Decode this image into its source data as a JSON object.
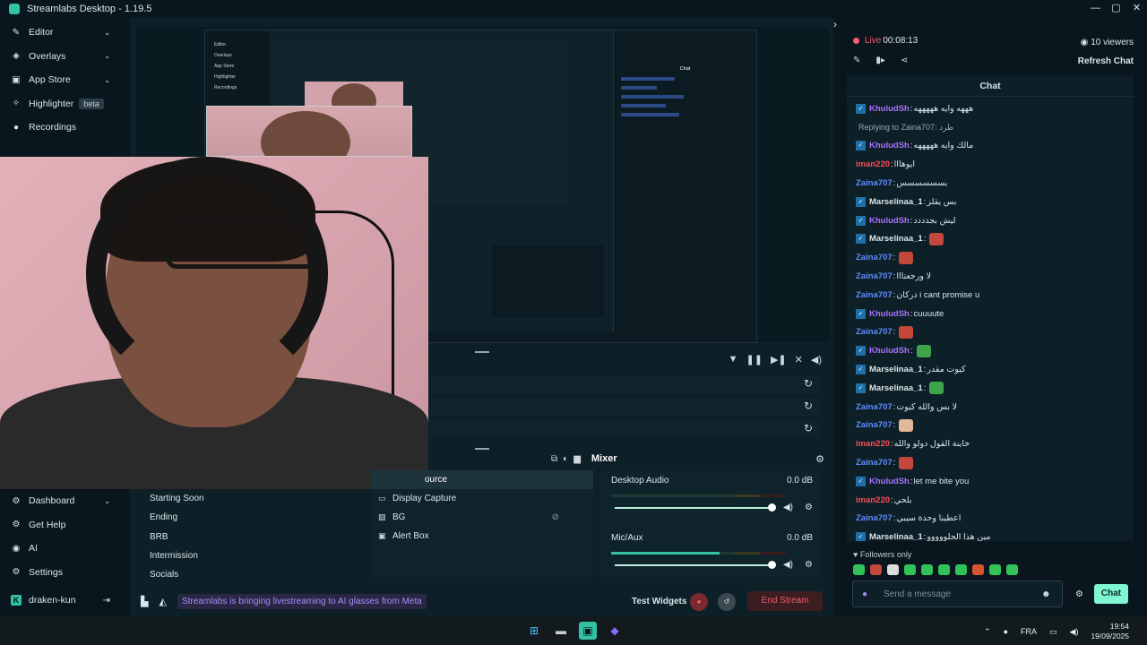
{
  "window": {
    "title": "Streamlabs Desktop - 1.19.5",
    "controls": [
      "—",
      "▢",
      "✕"
    ]
  },
  "sidebar": {
    "items": [
      {
        "label": "Editor",
        "icon": "pencil-icon",
        "glyph": "✎",
        "chev": "⌄"
      },
      {
        "label": "Overlays",
        "icon": "overlays-icon",
        "glyph": "◈",
        "chev": "⌄"
      },
      {
        "label": "App Store",
        "icon": "store-icon",
        "glyph": "▣",
        "chev": "⌄"
      },
      {
        "label": "Highlighter",
        "icon": "highlighter-icon",
        "glyph": "✧",
        "badge": "beta"
      },
      {
        "label": "Recordings",
        "icon": "recordings-icon",
        "glyph": "●"
      }
    ],
    "bottom": [
      {
        "label": "Dashboard",
        "glyph": "⚙",
        "icon": "dashboard-icon",
        "chev": "⌄"
      },
      {
        "label": "Get Help",
        "glyph": "⚙",
        "icon": "help-icon"
      },
      {
        "label": "AI",
        "glyph": "◉",
        "icon": "ai-icon"
      },
      {
        "label": "Settings",
        "glyph": "⚙",
        "icon": "settings-icon"
      }
    ],
    "user": {
      "name": "draken-kun",
      "badge": "K",
      "logout": "⇥"
    }
  },
  "preview_nested": {
    "sidebar_items": [
      "Editor",
      "Overlays",
      "App Store",
      "Highlighter",
      "Recordings"
    ],
    "chat_title": "Chat"
  },
  "scenes": [
    "Starting Soon",
    "Ending",
    "BRB",
    "Intermission",
    "Socials"
  ],
  "sources": {
    "active_partial": "ource",
    "items": [
      {
        "label": "Display Capture",
        "glyph": "▭",
        "icon": "display-capture-icon"
      },
      {
        "label": "BG",
        "glyph": "▨",
        "icon": "image-icon",
        "hidden": true
      },
      {
        "label": "Alert Box",
        "glyph": "▣",
        "icon": "alert-box-icon"
      }
    ]
  },
  "mixer": {
    "title": "Mixer",
    "channels": [
      {
        "name": "Desktop Audio",
        "db": "0.0 dB",
        "level": 0
      },
      {
        "name": "Mic/Aux",
        "db": "0.0 dB",
        "level": 0.62
      }
    ]
  },
  "footer": {
    "banner": "Streamlabs is bringing livestreaming to AI glasses from Meta",
    "test_widgets": "Test Widgets",
    "end_stream": "End Stream"
  },
  "chat": {
    "live_time": "00:08:13",
    "live_label": "Live",
    "viewers": "10 viewers",
    "refresh": "Refresh Chat",
    "header": "Chat",
    "reply": "Replying to Zaina707: طرد",
    "messages": [
      {
        "user": "KhuludSh",
        "color": "#a970ff",
        "text": "هههه وايه هههههه",
        "badge": true
      },
      {
        "user": "KhuludSh",
        "color": "#a970ff",
        "text": "مالك وايه هههههه",
        "badge": true
      },
      {
        "user": "iman220",
        "color": "#ff4a5a",
        "text": "ايوهااا",
        "badge": false
      },
      {
        "user": "Zaina707",
        "color": "#5f8cff",
        "text": "بسسسسسس",
        "badge": false
      },
      {
        "user": "Marselinaa_1",
        "color": "#dbe6ea",
        "text": "بس يقلز",
        "badge": true
      },
      {
        "user": "KhuludSh",
        "color": "#a970ff",
        "text": "ليش بجدددد",
        "badge": true
      },
      {
        "user": "Marselinaa_1",
        "color": "#dbe6ea",
        "text": "",
        "badge": true,
        "emote": "#c4473b"
      },
      {
        "user": "Zaina707",
        "color": "#5f8cff",
        "text": "",
        "badge": false,
        "emote": "#c4473b"
      },
      {
        "user": "Zaina707",
        "color": "#5f8cff",
        "text": "لا ورجعتااا",
        "badge": false
      },
      {
        "user": "Zaina707",
        "color": "#5f8cff",
        "text": "دركان i cant promise u",
        "badge": false
      },
      {
        "user": "KhuludSh",
        "color": "#a970ff",
        "text": "cuuuute",
        "badge": true
      },
      {
        "user": "Zaina707",
        "color": "#5f8cff",
        "text": "",
        "badge": false,
        "emote": "#c4473b"
      },
      {
        "user": "KhuludSh",
        "color": "#a970ff",
        "text": "",
        "badge": true,
        "emote": "#3ea34a"
      },
      {
        "user": "Marselinaa_1",
        "color": "#dbe6ea",
        "text": "كيوت مقدر",
        "badge": true
      },
      {
        "user": "Marselinaa_1",
        "color": "#dbe6ea",
        "text": "",
        "badge": true,
        "emote": "#3ea34a"
      },
      {
        "user": "Zaina707",
        "color": "#5f8cff",
        "text": "لا بس والله كيوت",
        "badge": false
      },
      {
        "user": "Zaina707",
        "color": "#5f8cff",
        "text": "",
        "badge": false,
        "emote": "#e0b89a"
      },
      {
        "user": "iman220",
        "color": "#ff4a5a",
        "text": "خاينة القول دولو والله",
        "badge": false
      },
      {
        "user": "Zaina707",
        "color": "#5f8cff",
        "text": "",
        "badge": false,
        "emote": "#c4473b"
      },
      {
        "user": "KhuludSh",
        "color": "#a970ff",
        "text": "let me bite you",
        "badge": true
      },
      {
        "user": "iman220",
        "color": "#ff4a5a",
        "text": "بلحي",
        "badge": false
      },
      {
        "user": "Zaina707",
        "color": "#5f8cff",
        "text": "اعطينا وحدة سيبي",
        "badge": false
      },
      {
        "user": "Marselinaa_1",
        "color": "#dbe6ea",
        "text": "مين هذا الحلووووو",
        "badge": true
      }
    ],
    "followers_only": "Followers only",
    "input_placeholder": "Send a message",
    "send": "Chat"
  },
  "taskbar": {
    "lang": "FRA",
    "time": "19:54",
    "date": "19/09/2025"
  }
}
